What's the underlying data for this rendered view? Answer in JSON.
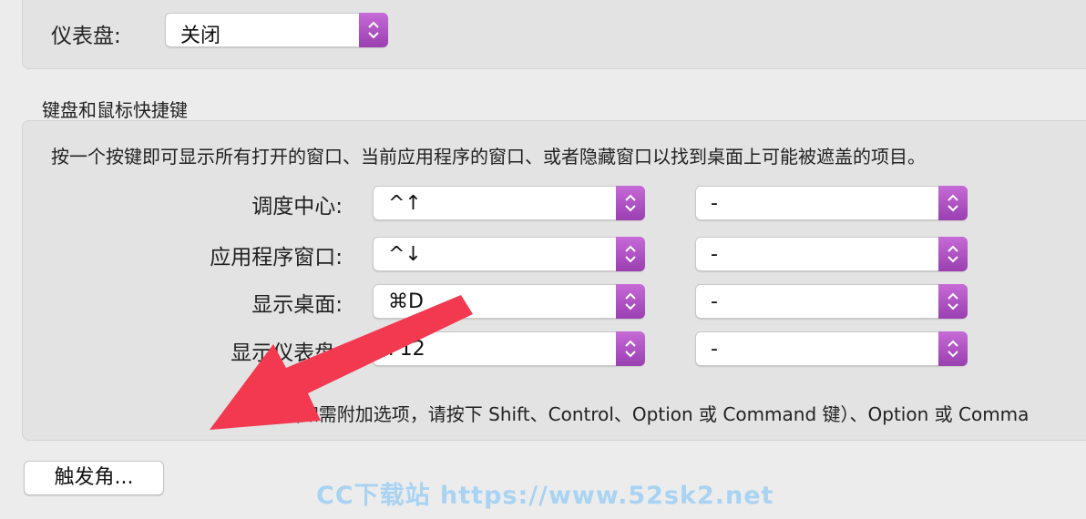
{
  "dashboard": {
    "label": "仪表盘:",
    "value": "关闭"
  },
  "shortcuts": {
    "title": "键盘和鼠标快捷键",
    "description": "按一个按键即可显示所有打开的窗口、当前应用程序的窗口、或者隐藏窗口以找到桌面上可能被遮盖的项目。",
    "rows": [
      {
        "label": "调度中心:",
        "key": "^↑",
        "mouse": "-"
      },
      {
        "label": "应用程序窗口:",
        "key": "^↓",
        "mouse": "-"
      },
      {
        "label": "显示桌面:",
        "key": "⌘D",
        "mouse": "-"
      },
      {
        "label": "显示仪表盘:",
        "key": "F12",
        "mouse": "-"
      }
    ],
    "footnote": "(如需附加选项，请按下 Shift、Control、Option 或 Command 键）、Option 或 Comma"
  },
  "hot_corners_button": "触发角...",
  "watermark": "CC下载站 https://www.52sk2.net",
  "colors": {
    "accent": "#b055c8",
    "arrow": "#f2394f",
    "watermark": "#a9d3f2"
  }
}
